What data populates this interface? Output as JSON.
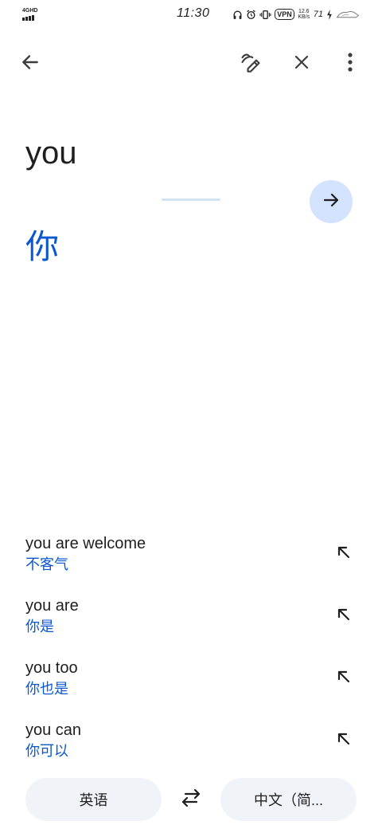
{
  "status_bar": {
    "network": "4GHD",
    "time": "11:30",
    "vpn": "VPN",
    "speed_value": "12.6",
    "speed_unit": "KB/s",
    "battery": "71"
  },
  "toolbar": {
    "back_icon": "arrow-back-icon",
    "draw_icon": "handwriting-icon",
    "close_icon": "close-icon",
    "more_icon": "more-vert-icon"
  },
  "input": {
    "source_text": "you",
    "translation": "你",
    "go_icon": "arrow-forward-icon"
  },
  "suggestions": [
    {
      "source": "you are welcome",
      "translation": "不客气"
    },
    {
      "source": "you are",
      "translation": "你是"
    },
    {
      "source": "you too",
      "translation": "你也是"
    },
    {
      "source": "you can",
      "translation": "你可以"
    }
  ],
  "languages": {
    "source": "英语",
    "target": "中文（简...",
    "swap_icon": "swap-horiz-icon"
  },
  "colors": {
    "accent": "#0b57d0",
    "go_button_bg": "#d3e3fd",
    "pill_bg": "#f0f4f9"
  }
}
